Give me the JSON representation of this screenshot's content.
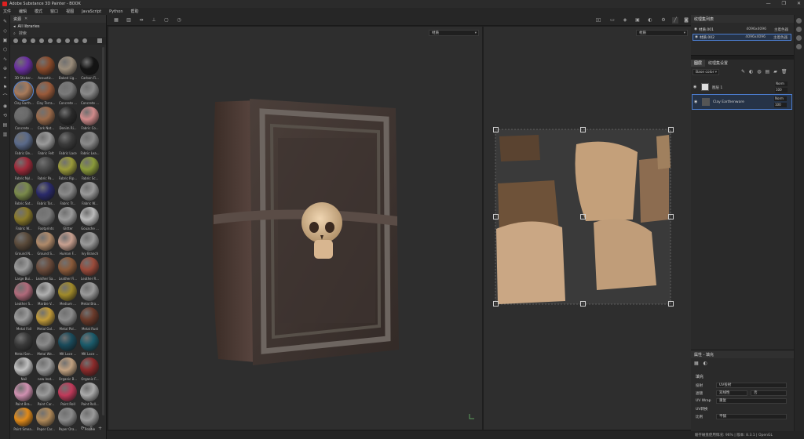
{
  "window": {
    "title": "Adobe Substance 3D Painter - BOOK",
    "controls": [
      "—",
      "❐",
      "✕"
    ]
  },
  "menu": [
    "文件",
    "编辑",
    "模式",
    "窗口",
    "视图",
    "JavaScript",
    "Python",
    "帮助"
  ],
  "library": {
    "panel_title": "资源",
    "breadcrumb": "All libraries",
    "search_placeholder": "搜索",
    "materials": [
      {
        "label": "3D Sticker...",
        "color": "#6a2fa0"
      },
      {
        "label": "Acoustic...",
        "color": "#8a4a2a"
      },
      {
        "label": "Baked Lig...",
        "color": "#9a8c7a"
      },
      {
        "label": "Carbon Fi...",
        "color": "#151515"
      },
      {
        "label": "Clay Earth...",
        "color": "#a87a5a"
      },
      {
        "label": "Clay Terra...",
        "color": "#9a5a3a"
      },
      {
        "label": "Concrete ...",
        "color": "#7a7a7a"
      },
      {
        "label": "Concrete ...",
        "color": "#8a8a8a"
      },
      {
        "label": "Concrete ...",
        "color": "#6a6a6a"
      },
      {
        "label": "Cork Nat...",
        "color": "#9a6a4a"
      },
      {
        "label": "Denim Ri...",
        "color": "#2a2a2a"
      },
      {
        "label": "Fabric Co...",
        "color": "#d08a8a"
      },
      {
        "label": "Fabric De...",
        "color": "#5a6a8a"
      },
      {
        "label": "Fabric Felt",
        "color": "#9a9a9a"
      },
      {
        "label": "Fabric Lace",
        "color": "#3a3a3a"
      },
      {
        "label": "Fabric Lea...",
        "color": "#8a8a8a"
      },
      {
        "label": "Fabric Nyl...",
        "color": "#a02a3a"
      },
      {
        "label": "Fabric Pa...",
        "color": "#4a4a4a"
      },
      {
        "label": "Fabric Rip...",
        "color": "#9a9a3a"
      },
      {
        "label": "Fabric Sc...",
        "color": "#8a9a3a"
      },
      {
        "label": "Fabric Sat...",
        "color": "#7a8a4a"
      },
      {
        "label": "Fabric Tar...",
        "color": "#2a2a6a"
      },
      {
        "label": "Fabric Tr...",
        "color": "#8a8a8a"
      },
      {
        "label": "Fabric W...",
        "color": "#9a9a9a"
      },
      {
        "label": "Fabric W...",
        "color": "#8a7a2a"
      },
      {
        "label": "Footprints",
        "color": "#7a7a7a"
      },
      {
        "label": "Glitter",
        "color": "#9a9a9a"
      },
      {
        "label": "Gouache ...",
        "color": "#bababa"
      },
      {
        "label": "Ground N...",
        "color": "#5a4a3a"
      },
      {
        "label": "Ground S...",
        "color": "#b08a6a"
      },
      {
        "label": "Human F...",
        "color": "#c8a090"
      },
      {
        "label": "Ivy Branch",
        "color": "#9a9a9a"
      },
      {
        "label": "Large Bui...",
        "color": "#9a9a9a"
      },
      {
        "label": "Leather Sa...",
        "color": "#6a4a3a"
      },
      {
        "label": "Leather Fi...",
        "color": "#8a5a3a"
      },
      {
        "label": "Leather R...",
        "color": "#9a4a3a"
      },
      {
        "label": "Leather S...",
        "color": "#b06a7a"
      },
      {
        "label": "Marble V...",
        "color": "#b0b0b0"
      },
      {
        "label": "Medium ...",
        "color": "#a08a2a"
      },
      {
        "label": "Metal Bra...",
        "color": "#9a9a9a"
      },
      {
        "label": "Metal Foil",
        "color": "#9a9a9a"
      },
      {
        "label": "Metal Gol...",
        "color": "#c09a3a"
      },
      {
        "label": "Metal Pol...",
        "color": "#8a8a8a"
      },
      {
        "label": "Metal Rust",
        "color": "#6a3a2a"
      },
      {
        "label": "Metal Sen...",
        "color": "#3a3a3a"
      },
      {
        "label": "Metal We...",
        "color": "#8a8a8a"
      },
      {
        "label": "MK Lace ...",
        "color": "#1a4a5a"
      },
      {
        "label": "MK Lace ...",
        "color": "#1a5a6a"
      },
      {
        "label": "Nail",
        "color": "#c0c0c0"
      },
      {
        "label": "new leat...",
        "color": "#9a9a9a"
      },
      {
        "label": "Organic B...",
        "color": "#c0a080"
      },
      {
        "label": "Organic F...",
        "color": "#8a2a2a"
      },
      {
        "label": "Paint Bra...",
        "color": "#d090b0"
      },
      {
        "label": "Paint Car...",
        "color": "#9a9a9a"
      },
      {
        "label": "Paint Roll",
        "color": "#c03a5a"
      },
      {
        "label": "Paint Roll...",
        "color": "#aaaaaa"
      },
      {
        "label": "Paint Smea...",
        "color": "#e08a1a"
      },
      {
        "label": "Paper Car...",
        "color": "#b08a5a"
      },
      {
        "label": "Paper Ora...",
        "color": "#8a8a8a"
      },
      {
        "label": "Pebble",
        "color": "#9a9a9a"
      }
    ]
  },
  "viewport3d": {
    "mode_label": "材质"
  },
  "viewport2d": {
    "mode_label": "材质"
  },
  "texture_sets": {
    "panel_title": "纹理集列表",
    "rows": [
      {
        "name": "材质.001",
        "resolution": "4096x4096",
        "shader": "主着色器"
      },
      {
        "name": "材质.002",
        "resolution": "4096x4096",
        "shader": "主着色器"
      }
    ]
  },
  "layers": {
    "tabs": [
      "图层",
      "纹理集设置"
    ],
    "channel_label": "Base color",
    "rows": [
      {
        "name": "图层 1",
        "blend": "Norm",
        "opacity": "100"
      },
      {
        "name": "Clay Earthenware",
        "blend": "Norm",
        "opacity": "100"
      }
    ]
  },
  "properties": {
    "panel_title": "属性 - 填充",
    "section": "填充",
    "fields": [
      {
        "key": "投射",
        "value": "UV投射"
      },
      {
        "key": "滤镜",
        "value": "双线性",
        "value2": "否"
      },
      {
        "key": "UV Wrap",
        "value": "重复"
      },
      {
        "key": "UV转换",
        "value": ""
      },
      {
        "key": "比例",
        "value": "平铺"
      }
    ]
  },
  "status": {
    "text": "缓存磁盘使用情况: 96%  |  版本: 8.3.1  |  OpenGL"
  },
  "colors": {
    "accent": "#4c7ed0",
    "bg": "#1e1e1e",
    "panel": "#2a2a2a"
  }
}
